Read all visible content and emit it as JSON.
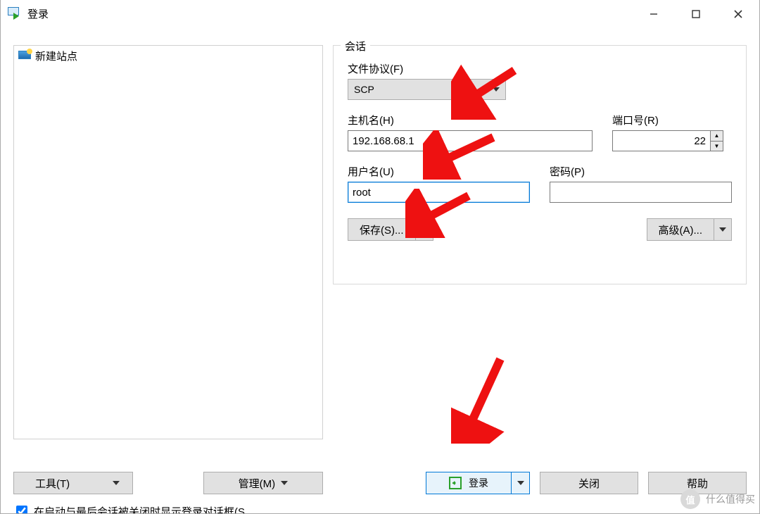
{
  "window": {
    "title": "登录"
  },
  "sidebar": {
    "items": [
      {
        "label": "新建站点"
      }
    ]
  },
  "session": {
    "legend": "会话",
    "protocol_label": "文件协议(F)",
    "protocol_value": "SCP",
    "host_label": "主机名(H)",
    "host_value": "192.168.68.1",
    "port_label": "端口号(R)",
    "port_value": "22",
    "user_label": "用户名(U)",
    "user_value": "root",
    "password_label": "密码(P)",
    "password_value": "",
    "save_label": "保存(S)...",
    "advanced_label": "高级(A)..."
  },
  "tools": {
    "tools_label": "工具(T)",
    "manage_label": "管理(M)"
  },
  "actions": {
    "login_label": "登录",
    "close_label": "关闭",
    "help_label": "帮助"
  },
  "footer": {
    "checkbox_label": "在启动与最后会话被关闭时显示登录对话框(S",
    "checkbox_checked": true
  },
  "watermark": {
    "badge": "值",
    "text": "什么值得买"
  }
}
